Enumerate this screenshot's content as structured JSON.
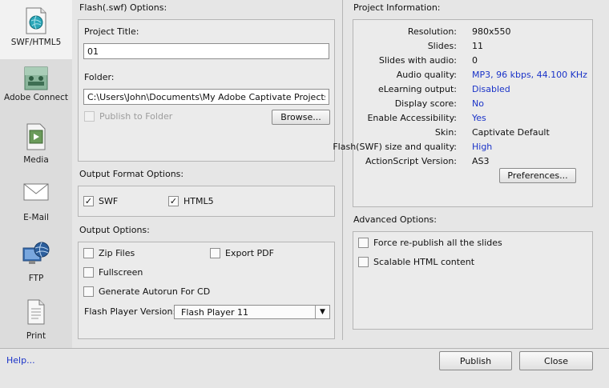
{
  "sidebar": {
    "items": [
      {
        "label": "SWF/HTML5",
        "icon": "swf-html5-icon",
        "active": true
      },
      {
        "label": "Adobe Connect",
        "icon": "adobe-connect-icon"
      },
      {
        "label": "Media",
        "icon": "media-icon"
      },
      {
        "label": "E-Mail",
        "icon": "email-icon"
      },
      {
        "label": "FTP",
        "icon": "ftp-icon"
      },
      {
        "label": "Print",
        "icon": "print-icon"
      }
    ]
  },
  "flash_options": {
    "title": "Flash(.swf) Options:",
    "project_title_label": "Project Title:",
    "project_title_value": "01",
    "folder_label": "Folder:",
    "folder_value": "C:\\Users\\John\\Documents\\My Adobe Captivate Projects",
    "publish_to_folder_label": "Publish to Folder",
    "browse_label": "Browse..."
  },
  "output_format": {
    "title": "Output Format Options:",
    "swf_label": "SWF",
    "swf_checked": true,
    "html5_label": "HTML5",
    "html5_checked": true
  },
  "output_options": {
    "title": "Output Options:",
    "zip_label": "Zip Files",
    "export_pdf_label": "Export PDF",
    "fullscreen_label": "Fullscreen",
    "autorun_label": "Generate Autorun For CD",
    "flash_version_label": "Flash Player Version:",
    "flash_version_value": "Flash Player 11"
  },
  "project_info": {
    "title": "Project Information:",
    "rows": [
      {
        "key": "Resolution:",
        "value": "980x550",
        "link": false
      },
      {
        "key": "Slides:",
        "value": "11",
        "link": false
      },
      {
        "key": "Slides with audio:",
        "value": "0",
        "link": false
      },
      {
        "key": "Audio quality:",
        "value": "MP3, 96 kbps, 44.100 KHz",
        "link": true
      },
      {
        "key": "eLearning output:",
        "value": "Disabled",
        "link": true
      },
      {
        "key": "Display score:",
        "value": "No",
        "link": true
      },
      {
        "key": "Enable Accessibility:",
        "value": "Yes",
        "link": true
      },
      {
        "key": "Skin:",
        "value": "Captivate Default",
        "link": false
      },
      {
        "key": "Flash(SWF) size and quality:",
        "value": "High",
        "link": true
      },
      {
        "key": "ActionScript Version:",
        "value": "AS3",
        "link": false
      }
    ],
    "preferences_label": "Preferences..."
  },
  "advanced": {
    "title": "Advanced Options:",
    "force_republish_label": "Force re-publish all the slides",
    "scalable_html_label": "Scalable HTML content"
  },
  "footer": {
    "help_label": "Help...",
    "publish_label": "Publish",
    "close_label": "Close"
  },
  "colors": {
    "link": "#1a33c8",
    "background": "#e6e6e6",
    "sidebar": "#dcdcdc"
  }
}
